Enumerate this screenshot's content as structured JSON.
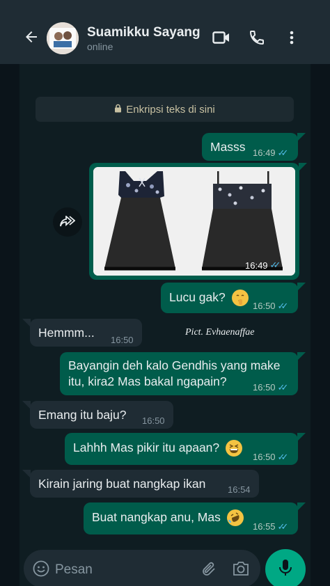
{
  "header": {
    "contact_name": "Suamikku Sayang",
    "status": "online",
    "icons": [
      "back-arrow-icon",
      "video-call-icon",
      "voice-call-icon",
      "more-vertical-icon"
    ]
  },
  "encryption_notice": "Enkripsi teks di sini",
  "watermark": "Pict. Evhaenaffae",
  "messages": [
    {
      "dir": "out",
      "text": "Masss",
      "time": "16:49",
      "read": true
    },
    {
      "dir": "out",
      "type": "image",
      "time": "16:49",
      "read": true
    },
    {
      "dir": "out",
      "text": "Lucu gak?",
      "emoji": "shushing-face",
      "time": "16:50",
      "read": true
    },
    {
      "dir": "in",
      "text": "Hemmm...",
      "time": "16:50"
    },
    {
      "dir": "out",
      "line1": "Bayangin deh kalo Gendhis yang make",
      "line2": "itu, kira2 Mas bakal ngapain?",
      "time": "16:50",
      "read": true
    },
    {
      "dir": "in",
      "text": "Emang itu baju?",
      "time": "16:50"
    },
    {
      "dir": "out",
      "text": "Lahhh Mas pikir itu apaan?",
      "emoji": "grinning-squinting-face",
      "time": "16:50",
      "read": true
    },
    {
      "dir": "in",
      "text": "Kirain jaring buat nangkap ikan",
      "time": "16:54"
    },
    {
      "dir": "out",
      "text": "Buat nangkap anu, Mas",
      "emoji": "rolling-on-floor-laughing",
      "time": "16:55",
      "read": true
    }
  ],
  "composer": {
    "placeholder": "Pesan",
    "icons": [
      "emoji-icon",
      "attach-icon",
      "camera-icon",
      "mic-icon"
    ]
  },
  "colors": {
    "header_bg": "#1f2c34",
    "outgoing_bubble": "#005c4b",
    "incoming_bubble": "#1f2c34",
    "read_ticks": "#53bdeb",
    "mic_button": "#00a884"
  }
}
